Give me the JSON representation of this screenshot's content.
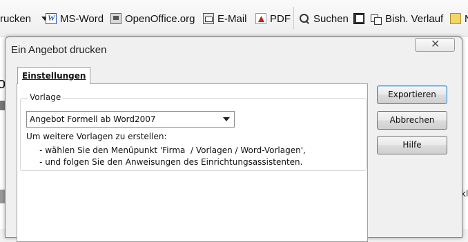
{
  "toolbar": {
    "items": [
      {
        "label": "rucken",
        "icon": "print-icon"
      },
      {
        "label": "MS-Word",
        "icon": "word-icon"
      },
      {
        "label": "OpenOffice.org",
        "icon": "openoffice-icon"
      },
      {
        "label": "E-Mail",
        "icon": "email-icon"
      },
      {
        "label": "PDF",
        "icon": "pdf-icon"
      },
      {
        "label": "Suchen",
        "icon": "search-icon"
      },
      {
        "label": "Bish. Verlauf",
        "icon": "history-icon"
      },
      {
        "label": "N",
        "icon": "note-icon"
      }
    ]
  },
  "dialog": {
    "title": "Ein Angebot drucken",
    "close_label": "✕",
    "tab_label": "Einstellungen",
    "group_label": "Vorlage",
    "select_value": "Angebot Formell ab Word2007",
    "info_line1": "Um weitere Vorlagen zu erstellen:",
    "info_line2": "     - wählen Sie den Menüpunkt 'Firma  / Vorlagen / Word-Vorlagen',",
    "info_line3": "     - und folgen Sie den Anweisungen des Einrichtungsassistenten.",
    "buttons": {
      "export": "Exportieren",
      "cancel": "Abbrechen",
      "help": "Hilfe"
    }
  },
  "background": {
    "left_fragment": "o",
    "right_fragment": "kl"
  }
}
